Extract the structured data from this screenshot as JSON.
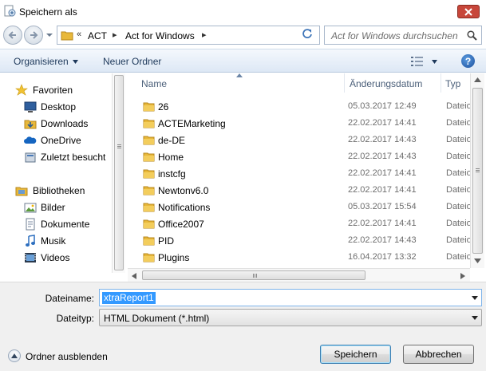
{
  "window": {
    "title": "Speichern als",
    "close_icon": "close-icon",
    "title_icon": "save-dialog-icon"
  },
  "address": {
    "prefix": "«",
    "crumbs": [
      "ACT",
      "Act for Windows"
    ],
    "search_placeholder": "Act for Windows durchsuchen"
  },
  "toolbar": {
    "organize_label": "Organisieren",
    "new_folder_label": "Neuer Ordner",
    "help_label": "?"
  },
  "nav": {
    "favorites": {
      "label": "Favoriten",
      "items": [
        "Desktop",
        "Downloads",
        "OneDrive",
        "Zuletzt besucht"
      ]
    },
    "libraries": {
      "label": "Bibliotheken",
      "items": [
        "Bilder",
        "Dokumente",
        "Musik",
        "Videos"
      ]
    }
  },
  "columns": {
    "name": "Name",
    "date": "Änderungsdatum",
    "type": "Typ"
  },
  "files": [
    {
      "name": "26",
      "date": "05.03.2017 12:49",
      "type": "Dateio"
    },
    {
      "name": "ACTEMarketing",
      "date": "22.02.2017 14:41",
      "type": "Dateio"
    },
    {
      "name": "de-DE",
      "date": "22.02.2017 14:43",
      "type": "Dateio"
    },
    {
      "name": "Home",
      "date": "22.02.2017 14:43",
      "type": "Dateio"
    },
    {
      "name": "instcfg",
      "date": "22.02.2017 14:41",
      "type": "Dateio"
    },
    {
      "name": "Newtonv6.0",
      "date": "22.02.2017 14:41",
      "type": "Dateio"
    },
    {
      "name": "Notifications",
      "date": "05.03.2017 15:54",
      "type": "Dateio"
    },
    {
      "name": "Office2007",
      "date": "22.02.2017 14:41",
      "type": "Dateio"
    },
    {
      "name": "PID",
      "date": "22.02.2017 14:43",
      "type": "Dateio"
    },
    {
      "name": "Plugins",
      "date": "16.04.2017 13:32",
      "type": "Dateio"
    }
  ],
  "form": {
    "filename_label": "Dateiname:",
    "filename_value": "xtraReport1",
    "filetype_label": "Dateityp:",
    "filetype_value": "HTML Dokument (*.html)"
  },
  "footer": {
    "hide_folders_label": "Ordner ausblenden",
    "save_label": "Speichern",
    "cancel_label": "Abbrechen"
  },
  "colors": {
    "accent_blue": "#3399ff",
    "close_red": "#c7463a",
    "folder_yellow": "#e8b83a"
  }
}
